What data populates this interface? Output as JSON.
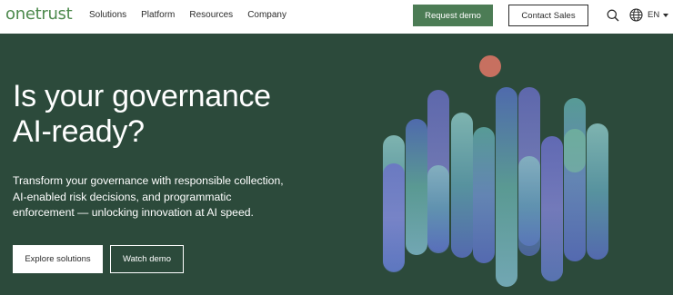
{
  "header": {
    "logo": "onetrust",
    "nav": [
      "Solutions",
      "Platform",
      "Resources",
      "Company"
    ],
    "request_demo": "Request demo",
    "contact_sales": "Contact Sales",
    "language": "EN"
  },
  "hero": {
    "title_lines": [
      "Is your governance",
      "AI-ready?"
    ],
    "body_lines": [
      "Transform your governance with responsible collection,",
      "AI-enabled risk decisions, and programmatic",
      "enforcement — unlocking innovation at AI speed."
    ],
    "explore_label": "Explore solutions",
    "watch_label": "Watch demo"
  },
  "colors": {
    "brand_green": "#4e8a4e",
    "button_green": "#4c7c55",
    "hero_bg": "#2c4a3b",
    "dot": "#c77060"
  },
  "icons": [
    "search-icon",
    "globe-icon",
    "chevron-down-icon"
  ]
}
